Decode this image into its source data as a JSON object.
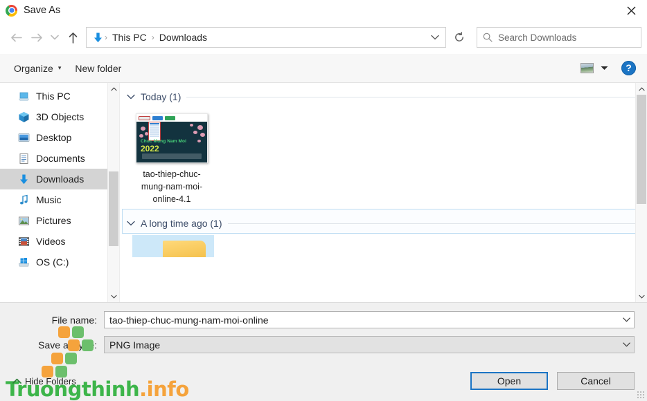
{
  "window": {
    "title": "Save As",
    "app_icon": "chrome-icon",
    "close_label": "✕"
  },
  "nav": {
    "back_icon": "back-arrow-icon",
    "forward_icon": "forward-arrow-icon",
    "history_icon": "chevron-down-icon",
    "up_icon": "up-arrow-icon",
    "location_icon": "downloads-arrow-icon",
    "breadcrumbs": [
      {
        "label": "This PC"
      },
      {
        "label": "Downloads"
      }
    ],
    "separator": "›",
    "address_dropdown_icon": "chevron-down-icon",
    "refresh_icon": "refresh-icon"
  },
  "search": {
    "icon": "search-icon",
    "placeholder": "Search Downloads",
    "value": ""
  },
  "toolbar": {
    "organize_label": "Organize",
    "organize_caret": "▾",
    "new_folder_label": "New folder",
    "view_icon": "picture-view-icon",
    "view_caret_icon": "chevron-down-icon",
    "help_icon": "help-icon",
    "help_label": "?"
  },
  "sidebar": {
    "items": [
      {
        "label": "This PC",
        "icon": "this-pc-icon",
        "selected": false
      },
      {
        "label": "3D Objects",
        "icon": "3d-objects-icon",
        "selected": false
      },
      {
        "label": "Desktop",
        "icon": "desktop-icon",
        "selected": false
      },
      {
        "label": "Documents",
        "icon": "documents-icon",
        "selected": false
      },
      {
        "label": "Downloads",
        "icon": "downloads-icon",
        "selected": true
      },
      {
        "label": "Music",
        "icon": "music-icon",
        "selected": false
      },
      {
        "label": "Pictures",
        "icon": "pictures-icon",
        "selected": false
      },
      {
        "label": "Videos",
        "icon": "videos-icon",
        "selected": false
      },
      {
        "label": "OS (C:)",
        "icon": "os-drive-icon",
        "selected": false
      }
    ]
  },
  "content": {
    "groups": [
      {
        "label": "Today (1)",
        "count": 1,
        "collapse_icon": "chevron-down-icon",
        "focused": false
      },
      {
        "label": "A long time ago (1)",
        "count": 1,
        "collapse_icon": "chevron-down-icon",
        "focused": true
      }
    ],
    "files": [
      {
        "name": "tao-thiep-chuc-mung-nam-moi-online-4.1",
        "thumbnail": {
          "title": "Chuc Mung Nam Moi",
          "year": "2022",
          "bg_color": "#13333f",
          "title_color": "#49d37a",
          "year_color": "#d8e84a"
        }
      }
    ]
  },
  "scrollbars": {
    "up_arrow_icon": "scroll-up-icon",
    "down_arrow_icon": "scroll-down-icon"
  },
  "form": {
    "file_name": {
      "label": "File name:",
      "value": "tao-thiep-chuc-mung-nam-moi-online",
      "caret_icon": "chevron-down-icon"
    },
    "save_as_type": {
      "label": "Save as type:",
      "value": "PNG Image",
      "caret_icon": "chevron-down-icon"
    }
  },
  "footer": {
    "hide_folders_label": "Hide Folders",
    "hide_folders_icon": "chevron-up-icon",
    "open_label": "Open",
    "cancel_label": "Cancel",
    "accent_color": "#1b74c4"
  },
  "watermark": {
    "text_part1": "Tru",
    "text_part2": "o",
    "text_part3": "ngthinh",
    "dot": ".",
    "text_part4": "info",
    "green": "#3db54a",
    "orange": "#f5a33c"
  }
}
